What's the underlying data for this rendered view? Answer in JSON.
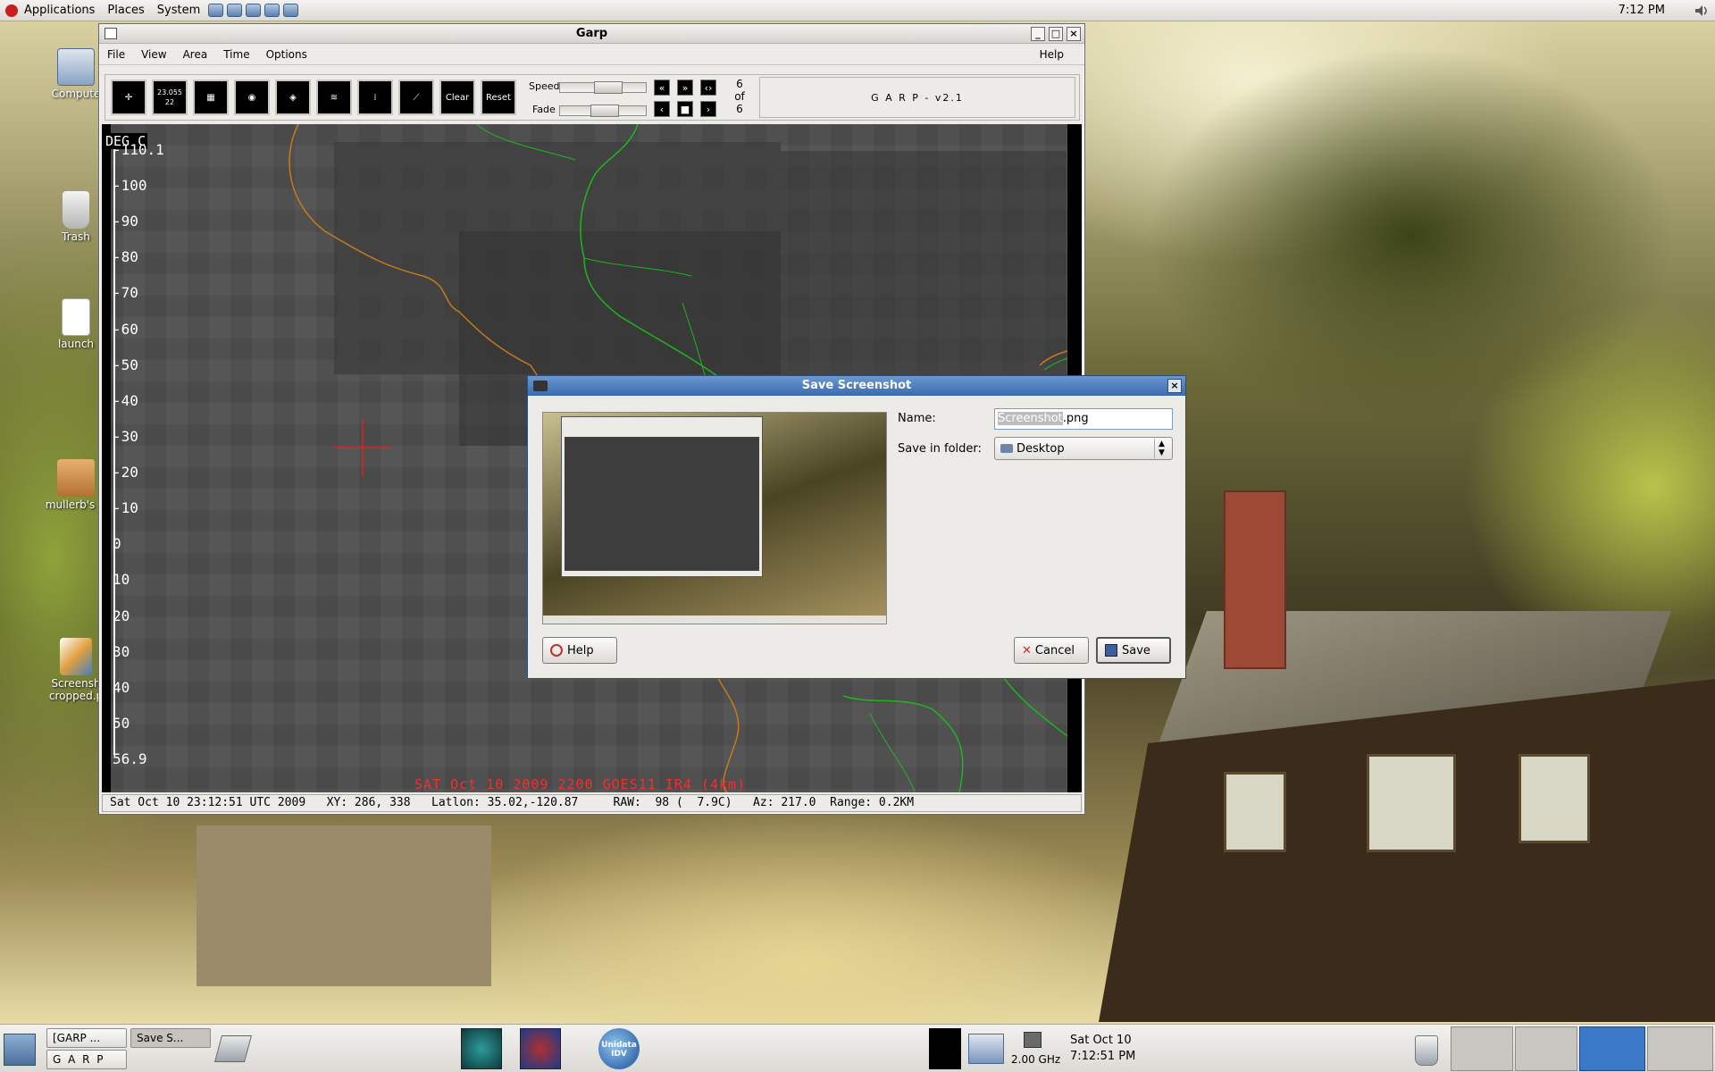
{
  "top_panel": {
    "menus": [
      "Applications",
      "Places",
      "System"
    ],
    "clock": "7:12 PM"
  },
  "desktop_icons": [
    "Compute",
    "Trash",
    "launch",
    "mullerb's H",
    "Screensh cropped.p"
  ],
  "garp": {
    "title": "Garp",
    "menus": [
      "File",
      "View",
      "Area",
      "Time",
      "Options"
    ],
    "help_menu": "Help",
    "tools": {
      "station_value": "23.055\n22",
      "clear": "Clear",
      "reset": "Reset"
    },
    "speed_label": "Speed",
    "fade_label": "Fade",
    "frame_count": "6\nof\n6",
    "version": "G A R P - v2.1",
    "scale_unit": "DEG C",
    "scale_labels": [
      "-110.1",
      "-100",
      "-90",
      "-80",
      "-70",
      "-60",
      "-50",
      "-40",
      "-30",
      "-20",
      "-10",
      "0",
      "10",
      "20",
      "30",
      "40",
      "50",
      "56.9"
    ],
    "map_caption": "SAT Oct 10 2009 2200 GOES11 IR4 (4km)",
    "status": "Sat Oct 10 23:12:51 UTC 2009   XY: 286, 338   Latlon: 35.02,-120.87     RAW:  98 (  7.9C)   Az: 217.0  Range: 0.2KM"
  },
  "dialog": {
    "title": "Save Screenshot",
    "name_label": "Name:",
    "name_selected": "Screenshot",
    "name_rest": ".png",
    "folder_label": "Save in folder:",
    "folder_value": "Desktop",
    "help_button": "Help",
    "cancel_button": "Cancel",
    "save_button": "Save"
  },
  "taskbar": {
    "tasks": [
      "[GARP ...",
      "Save S...",
      "G A R P"
    ],
    "idv_label": "Unidata IDV",
    "cpu_freq": "2.00 GHz",
    "date": "Sat Oct 10",
    "time": "7:12:51 PM"
  },
  "colors": {
    "state_lines": "#1fb51f",
    "coast_line": "#c77a1c",
    "cursor": "#e02020",
    "dialog_title": "#3a6aae"
  }
}
